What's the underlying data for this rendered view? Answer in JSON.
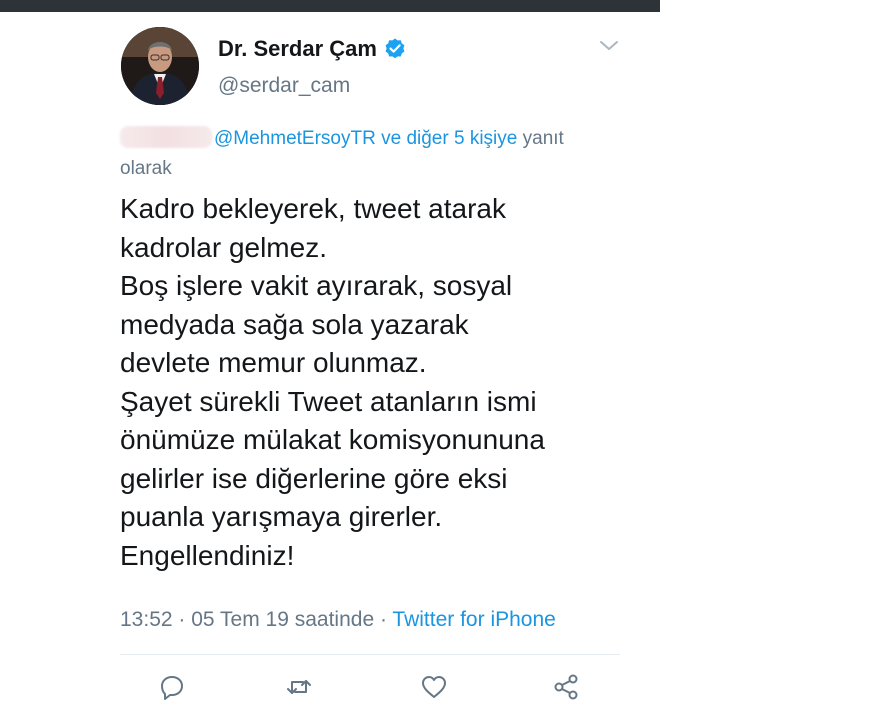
{
  "tweet": {
    "author": {
      "display_name": "Dr. Serdar Çam",
      "handle": "@serdar_cam",
      "verified": true
    },
    "reply_to": {
      "redacted_text": "",
      "mention": "@MehmetErsoyTR",
      "others": "ve diğer 5 kişiye",
      "suffix_1": "yanıt",
      "suffix_2": "olarak"
    },
    "text_lines": [
      "Kadro bekleyerek, tweet atarak",
      "kadrolar gelmez.",
      "Boş işlere vakit ayırarak, sosyal",
      "medyada sağa sola yazarak",
      "devlete memur olunmaz.",
      "Şayet sürekli Tweet atanların ismi",
      "önümüze mülakat komisyonununa",
      "gelirler ise diğerlerine göre eksi",
      "puanla yarışmaya girerler.",
      "Engellendiniz!"
    ],
    "timestamp": "13:52 · 05 Tem 19 saatinde ·",
    "source": "Twitter for iPhone"
  },
  "icons": {
    "menu": "chevron-down-icon",
    "verified": "verified-badge-icon",
    "reply": "reply-icon",
    "retweet": "retweet-icon",
    "like": "heart-icon",
    "share": "share-icon"
  },
  "colors": {
    "text": "#14171a",
    "secondary": "#657786",
    "link": "#1b95e0",
    "top_bar": "#2e3338",
    "divider": "#e6ecf0"
  }
}
